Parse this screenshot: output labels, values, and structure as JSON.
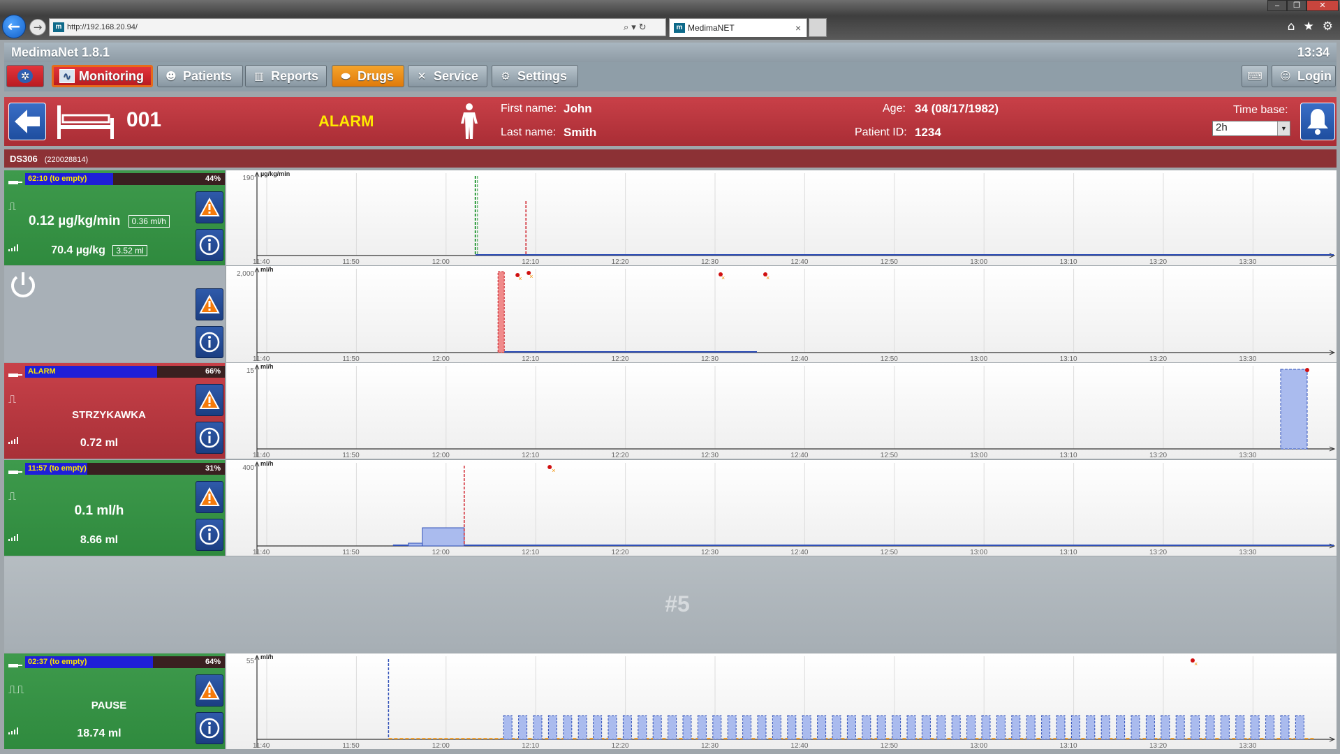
{
  "browser": {
    "url": "http://192.168.20.94/",
    "tab_title": "MedimaNET",
    "tab_close": "×"
  },
  "app": {
    "title": "MedimaNet 1.8.1",
    "clock": "13:34"
  },
  "menu": {
    "items": [
      {
        "label": "Monitoring",
        "icon": "monitor-icon"
      },
      {
        "label": "Patients",
        "icon": "patients-icon"
      },
      {
        "label": "Reports",
        "icon": "chart-icon"
      },
      {
        "label": "Drugs",
        "icon": "pills-icon"
      },
      {
        "label": "Service",
        "icon": "wrench-icon"
      },
      {
        "label": "Settings",
        "icon": "gears-icon"
      }
    ],
    "login": "Login",
    "active": "Monitoring"
  },
  "patient": {
    "bed": "001",
    "state": "ALARM",
    "first_name_label": "First name:",
    "first_name": "John",
    "last_name_label": "Last name:",
    "last_name": "Smith",
    "age_label": "Age:",
    "age": "34 (08/17/1982)",
    "id_label": "Patient ID:",
    "id": "1234",
    "timebase_label": "Time base:",
    "timebase": "2h"
  },
  "device": {
    "name": "DS306",
    "serial": "(220028814)"
  },
  "colors": {
    "panel_green": "#3e9a4c",
    "panel_red": "#c84149",
    "header_red": "#b8343c",
    "alarm_yellow": "#ffea00",
    "line_blue": "#3050b8",
    "bar_blue_fill": "#aabbee"
  },
  "channels": [
    {
      "state": "running",
      "progress_text": "62:10 (to empty)",
      "progress_pct_label": "44%",
      "progress_fraction": 0.44,
      "rate": "0.12",
      "rate_unit": "µg/kg/min",
      "rate_sub": "0.36",
      "rate_sub_unit": "ml/h",
      "dose": "70.4",
      "dose_unit": "µg/kg",
      "dose_sub": "3.52 ml",
      "chart": {
        "y_max_label": "190",
        "y_unit": "µg/kg/min"
      }
    },
    {
      "state": "off",
      "chart": {
        "y_max_label": "2,000",
        "y_unit": "ml/h"
      }
    },
    {
      "state": "alarm",
      "progress_text": "ALARM",
      "progress_pct_label": "66%",
      "progress_fraction": 0.66,
      "status": "STRZYKAWKA",
      "dose": "0.72",
      "dose_unit": "ml",
      "chart": {
        "y_max_label": "15",
        "y_unit": "ml/h"
      }
    },
    {
      "state": "running",
      "progress_text": "11:57 (to empty)",
      "progress_pct_label": "31%",
      "progress_fraction": 0.31,
      "rate": "0.1",
      "rate_unit": "ml/h",
      "dose": "8.66",
      "dose_unit": "ml",
      "chart": {
        "y_max_label": "400",
        "y_unit": "ml/h"
      }
    },
    {
      "state": "pause",
      "progress_text": "02:37 (to empty)",
      "progress_pct_label": "64%",
      "progress_fraction": 0.64,
      "status": "PAUSE",
      "dose": "18.74",
      "dose_unit": "ml",
      "chart": {
        "y_max_label": "55",
        "y_unit": "ml/h"
      }
    }
  ],
  "empty_slot_label": "#5",
  "time_ticks": [
    "11:40",
    "11:50",
    "12:00",
    "12:10",
    "12:20",
    "12:30",
    "12:40",
    "12:50",
    "13:00",
    "13:10",
    "13:20",
    "13:30"
  ]
}
